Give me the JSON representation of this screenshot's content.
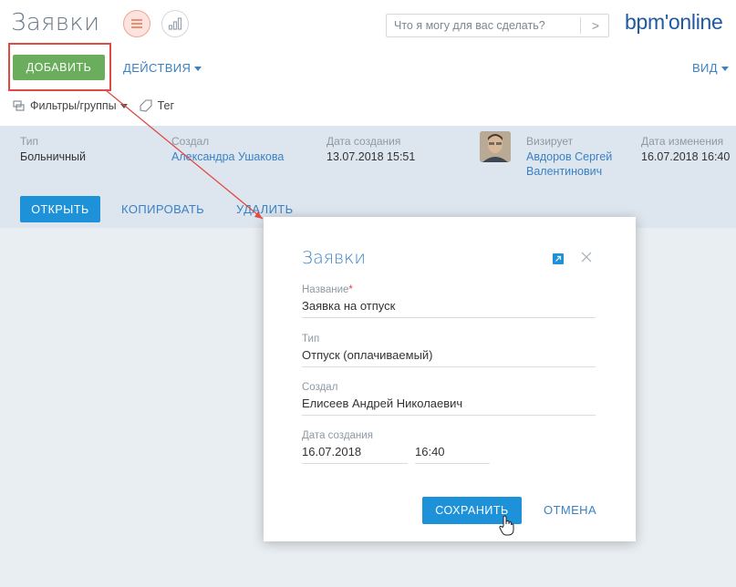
{
  "header": {
    "title": "Заявки",
    "search_placeholder": "Что я могу для вас сделать?",
    "logo": "bpm'online"
  },
  "toolbar": {
    "add_label": "ДОБАВИТЬ",
    "actions_label": "ДЕЙСТВИЯ",
    "view_label": "ВИД"
  },
  "filters": {
    "filter_label": "Фильтры/группы",
    "tag_label": "Тег"
  },
  "record": {
    "type_label": "Тип",
    "type_value": "Больничный",
    "created_by_label": "Создал",
    "created_by_value": "Александра Ушакова",
    "created_on_label": "Дата создания",
    "created_on_value": "13.07.2018 15:51",
    "approver_label": "Визирует",
    "approver_line1": "Авдоров Сергей",
    "approver_line2": "Валентинович",
    "modified_label": "Дата изменения",
    "modified_value": "16.07.2018 16:40",
    "open_label": "ОТКРЫТЬ",
    "copy_label": "КОПИРОВАТЬ",
    "delete_label": "УДАЛИТЬ"
  },
  "modal": {
    "title": "Заявки",
    "name_label": "Название",
    "name_required": "*",
    "name_value": "Заявка на отпуск",
    "type_label": "Тип",
    "type_value": "Отпуск (оплачиваемый)",
    "created_by_label": "Создал",
    "created_by_value": "Елисеев Андрей Николаевич",
    "date_label": "Дата создания",
    "date_value": "16.07.2018",
    "time_value": "16:40",
    "save_label": "СОХРАНИТЬ",
    "cancel_label": "ОТМЕНА"
  },
  "colors": {
    "brand_blue": "#1e92d9",
    "add_green": "#6aad5c",
    "highlight_red": "#e04a45"
  },
  "icons": [
    "list-view-icon",
    "chart-view-icon",
    "chevron-right-icon",
    "filter-icon",
    "tag-icon",
    "expand-icon",
    "close-icon",
    "hand-cursor-icon"
  ]
}
